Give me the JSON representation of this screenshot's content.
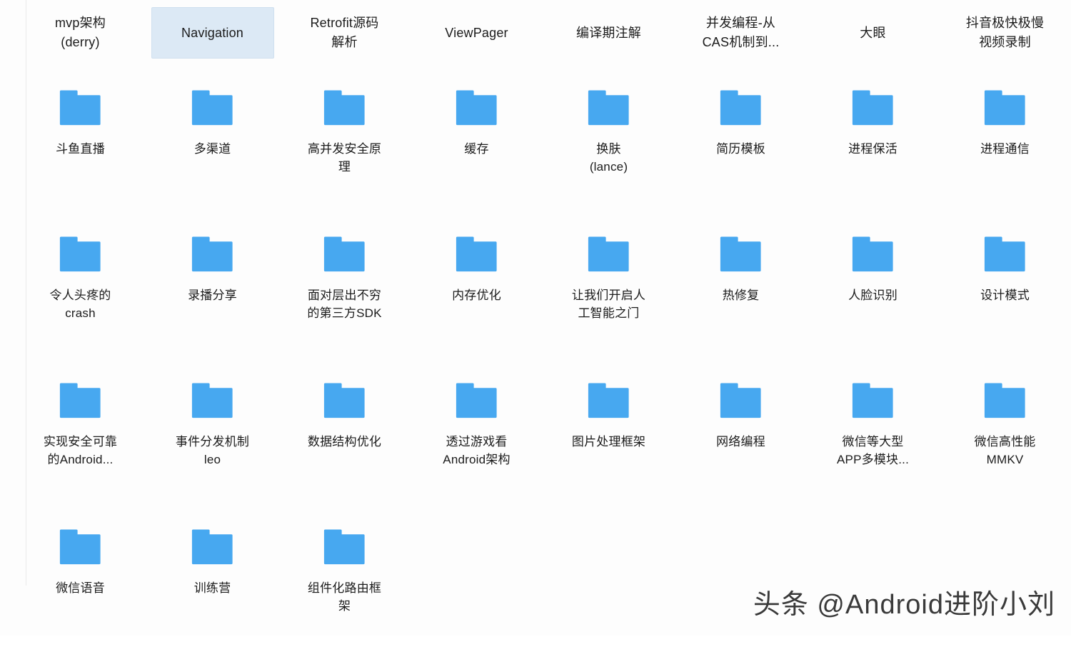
{
  "window": {
    "background_color": "#fdfdfd",
    "accent_color": "#47a8f0",
    "selection_color": "#dce9f5"
  },
  "breadcrumb": {
    "selected_index": 1,
    "tabs": [
      {
        "label": "mvp架构\n(derry)",
        "selected": false
      },
      {
        "label": "Navigation",
        "selected": true
      },
      {
        "label": "Retrofit源码\n解析",
        "selected": false
      },
      {
        "label": "ViewPager",
        "selected": false
      },
      {
        "label": "编译期注解",
        "selected": false
      },
      {
        "label": "并发编程-从\nCAS机制到...",
        "selected": false
      },
      {
        "label": "大眼",
        "selected": false
      },
      {
        "label": "抖音极快极慢\n视频录制",
        "selected": false
      }
    ]
  },
  "folders": {
    "icon_name": "folder-icon",
    "count": 27,
    "items": [
      {
        "label": "斗鱼直播"
      },
      {
        "label": "多渠道"
      },
      {
        "label": "高并发安全原\n理"
      },
      {
        "label": "缓存"
      },
      {
        "label": "换肤\n(lance)"
      },
      {
        "label": "简历模板"
      },
      {
        "label": "进程保活"
      },
      {
        "label": "进程通信"
      },
      {
        "label": "令人头疼的\ncrash"
      },
      {
        "label": "录播分享"
      },
      {
        "label": "面对层出不穷\n的第三方SDK"
      },
      {
        "label": "内存优化"
      },
      {
        "label": "让我们开启人\n工智能之门"
      },
      {
        "label": "热修复"
      },
      {
        "label": "人脸识别"
      },
      {
        "label": "设计模式"
      },
      {
        "label": "实现安全可靠\n的Android..."
      },
      {
        "label": "事件分发机制\nleo"
      },
      {
        "label": "数据结构优化"
      },
      {
        "label": "透过游戏看\nAndroid架构"
      },
      {
        "label": "图片处理框架"
      },
      {
        "label": "网络编程"
      },
      {
        "label": "微信等大型\nAPP多模块..."
      },
      {
        "label": "微信高性能\nMMKV"
      },
      {
        "label": "微信语音"
      },
      {
        "label": "训练营"
      },
      {
        "label": "组件化路由框\n架"
      }
    ]
  },
  "watermark": {
    "text": "头条 @Android进阶小刘"
  }
}
